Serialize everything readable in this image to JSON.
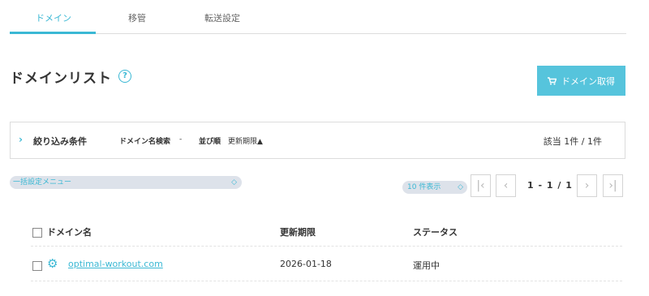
{
  "tabs": [
    {
      "label": "ドメイン",
      "active": true
    },
    {
      "label": "移管",
      "active": false
    },
    {
      "label": "転送設定",
      "active": false
    }
  ],
  "page": {
    "title": "ドメインリスト",
    "help_icon": "question-circle-icon",
    "acquire_button": "ドメイン取得",
    "cart_icon": "cart-icon"
  },
  "filter": {
    "expand_icon": "chevron-right-icon",
    "label": "絞り込み条件",
    "search_label": "ドメイン名検索",
    "search_value": "-",
    "sort_label": "並び順",
    "sort_value": "更新期限▲",
    "count": "該当 1件 / 1件"
  },
  "bulk_menu": {
    "selected": "一括設定メニュー"
  },
  "pagination": {
    "per_page": "10 件表示",
    "first": "|‹",
    "prev": "‹",
    "info": "1 - 1 / 1",
    "next": "›",
    "last": "›|"
  },
  "table": {
    "headers": {
      "name": "ドメイン名",
      "expiry": "更新期限",
      "status": "ステータス"
    },
    "rows": [
      {
        "icon": "gear-icon",
        "domain": "optimal-workout.com",
        "expiry": "2026-01-18",
        "status": "運用中"
      }
    ]
  },
  "colors": {
    "accent": "#3bb8d4",
    "button": "#56c4dc",
    "select_bg": "#dde2ea"
  }
}
